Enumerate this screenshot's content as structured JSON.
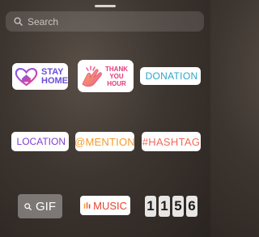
{
  "search": {
    "placeholder": "Search"
  },
  "stickers": {
    "stay_home": {
      "line1": "STAY",
      "line2": "HOME"
    },
    "thank_you": {
      "line1": "THANK",
      "line2": "YOU",
      "line3": "HOUR"
    },
    "donation": {
      "label": "DONATION"
    },
    "location": {
      "label": "LOCATION"
    },
    "mention": {
      "label": "@MENTION"
    },
    "hashtag": {
      "label": "#HASHTAG"
    },
    "gif": {
      "label": "GIF"
    },
    "music": {
      "label": "MUSIC"
    },
    "clock": {
      "digits": [
        "1",
        "1",
        "5",
        "6"
      ]
    }
  },
  "colors": {
    "stay_home": "#6c4dd8",
    "thank_you": "#e33a7a",
    "donation": "#2fa6c9",
    "location": "#7a3fd1",
    "mention": "#f39a2c",
    "hashtag": "#ef6b5a",
    "music": "#e8452f"
  }
}
